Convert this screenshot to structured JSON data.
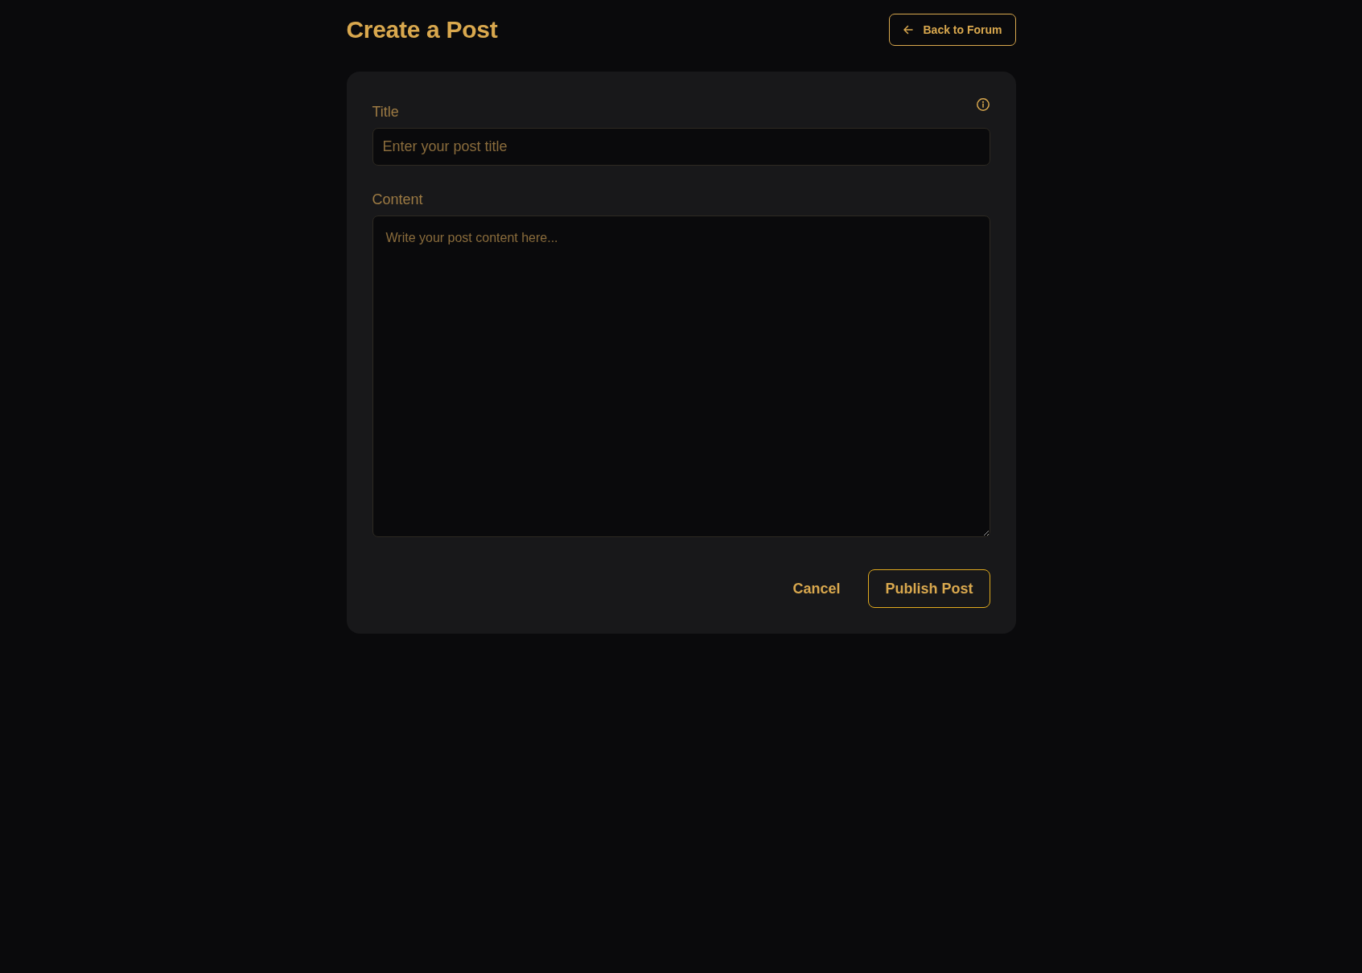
{
  "header": {
    "title": "Create a Post",
    "back_button": "Back to Forum"
  },
  "form": {
    "fields": [
      {
        "kind": "input",
        "label": "Title",
        "placeholder": "Enter your post title"
      },
      {
        "kind": "textarea",
        "label": "Content",
        "placeholder": "Write your post content here..."
      }
    ],
    "buttons": [
      {
        "kind": "plain",
        "label": "Cancel"
      },
      {
        "kind": "outlined",
        "label": "Publish Post"
      }
    ]
  }
}
